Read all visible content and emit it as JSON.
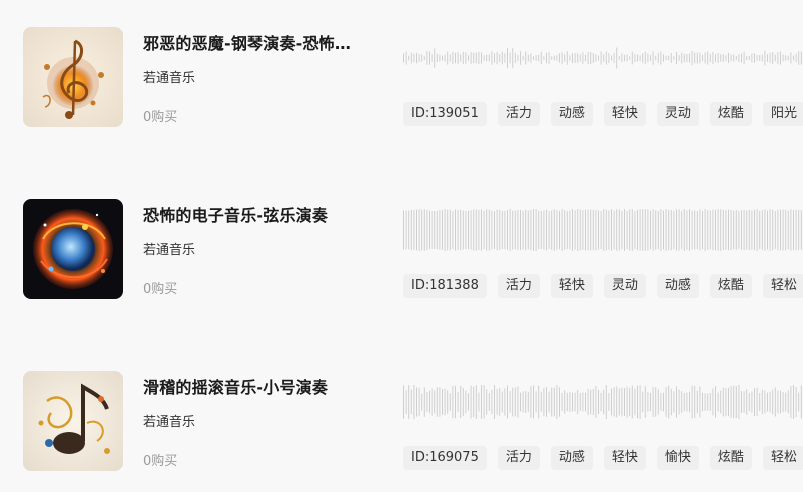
{
  "tracks": [
    {
      "title": "邪恶的恶魔-钢琴演奏-恐怖音乐",
      "artist": "若通音乐",
      "purchases": "0购买",
      "tags": [
        "ID:139051",
        "活力",
        "动感",
        "轻快",
        "灵动",
        "炫酷",
        "阳光"
      ],
      "cover_icon": "golden-treble-clef-art"
    },
    {
      "title": "恐怖的电子音乐-弦乐演奏",
      "artist": "若通音乐",
      "purchases": "0购买",
      "tags": [
        "ID:181388",
        "活力",
        "轻快",
        "灵动",
        "动感",
        "炫酷",
        "轻松"
      ],
      "cover_icon": "fiery-music-orb-art"
    },
    {
      "title": "滑稽的摇滚音乐-小号演奏",
      "artist": "若通音乐",
      "purchases": "0购买",
      "tags": [
        "ID:169075",
        "活力",
        "动感",
        "轻快",
        "愉快",
        "炫酷",
        "轻松"
      ],
      "cover_icon": "ornate-music-note-art"
    }
  ]
}
